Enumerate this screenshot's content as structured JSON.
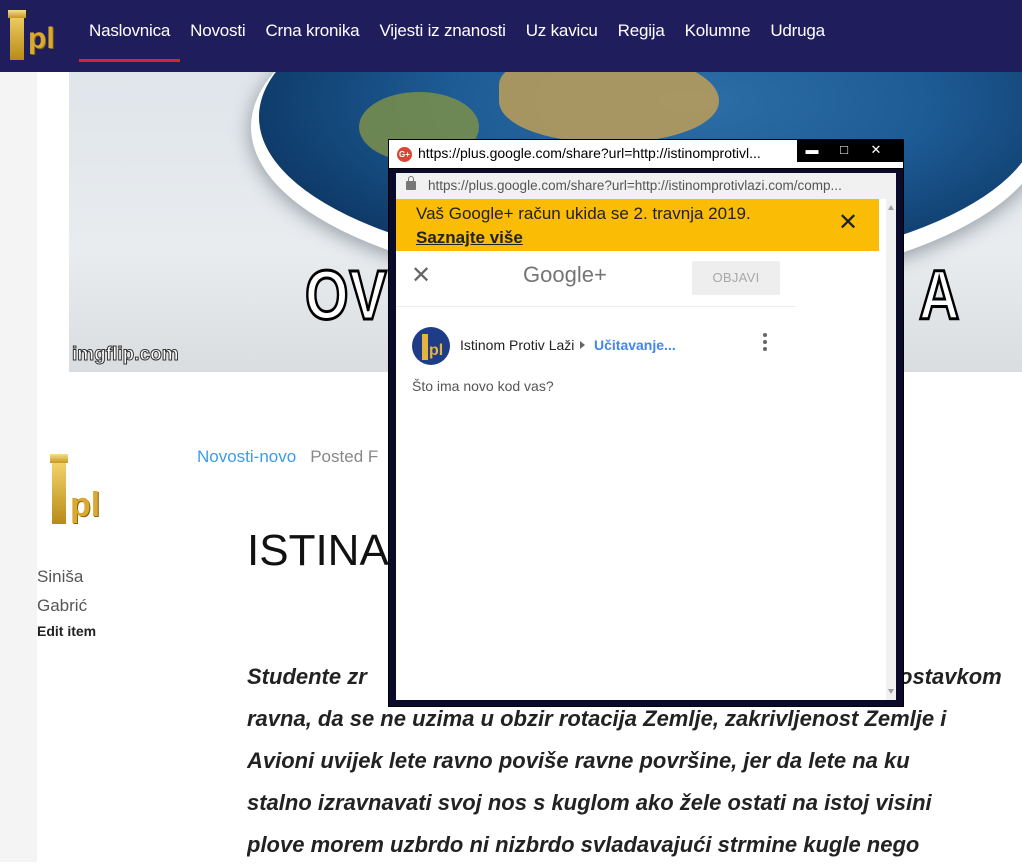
{
  "site": {
    "logo_text": "pl",
    "nav": [
      {
        "label": "Naslovnica",
        "active": true
      },
      {
        "label": "Novosti"
      },
      {
        "label": "Crna kronika"
      },
      {
        "label": "Vijesti iz znanosti"
      },
      {
        "label": "Uz kavicu"
      },
      {
        "label": "Regija"
      },
      {
        "label": "Kolumne"
      },
      {
        "label": "Udruga"
      }
    ]
  },
  "hero": {
    "meme_left": "OV",
    "meme_right": "A",
    "watermark": "imgflip.com"
  },
  "article": {
    "author_first": "Siniša",
    "author_last": "Gabrić",
    "edit_label": "Edit item",
    "category": "Novosti-novo",
    "posted": "Posted F",
    "headline": "ISTINA",
    "body_lines": [
      "Studente zr",
      "ravna, da se ne uzima u obzir rotacija Zemlje, zakrivljenost Zemlje i",
      "Avioni uvijek lete ravno poviše ravne površine, jer da lete na ku",
      "stalno izravnavati svoj nos s kuglom ako žele ostati na istoj visini",
      "plove morem uzbrdo ni nizbrdo svladavajući strmine kugle nego"
    ],
    "body_line1_right": "ostavkom"
  },
  "popup": {
    "favicon": "G+",
    "window_title": "https://plus.google.com/share?url=http://istinomprotivl...",
    "controls": {
      "minimize": "▬",
      "maximize": "□",
      "close": "✕"
    },
    "address": "https://plus.google.com/share?url=http://istinomprotivlazi.com/comp...",
    "banner_message": "Vaš Google+ račun ukida se 2. travnja 2019.",
    "banner_link": "Saznajte više",
    "banner_close": "✕",
    "header_close": "✕",
    "google_logo": "Google+",
    "publish_label": "OBJAVI",
    "poster_name": "Istinom Protiv Laži",
    "audience_loading": "Učitavanje...",
    "prompt": "Što ima novo kod vas?"
  }
}
